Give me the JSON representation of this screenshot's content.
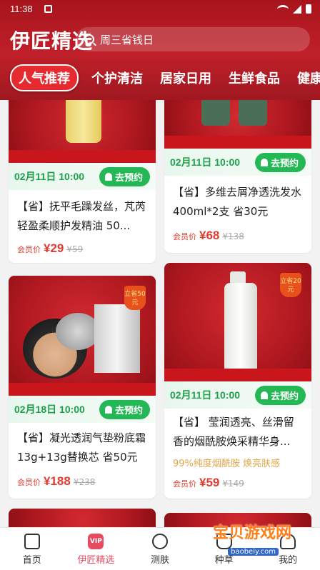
{
  "status_bar": {
    "time": "11:38"
  },
  "header": {
    "brand": "伊匠精选",
    "search_placeholder": "周三省钱日"
  },
  "tabs": [
    {
      "label": "人气推荐",
      "active": true
    },
    {
      "label": "个护清洁"
    },
    {
      "label": "居家日用"
    },
    {
      "label": "生鲜食品"
    },
    {
      "label": "健康"
    }
  ],
  "products": [
    {
      "time": "02月11日 10:00",
      "remind": "去预约",
      "title": "【省】抚平毛躁发丝，芃芮轻盈柔顺护发精油 50...",
      "member_label": "会员价",
      "price": "¥29",
      "original": "¥59"
    },
    {
      "time": "02月11日 10:00",
      "remind": "去预约",
      "title": "【省】多维去屑净透洗发水400ml*2支 省30元",
      "member_label": "会员价",
      "price": "¥68",
      "original": "¥138"
    },
    {
      "badge": "立省50元",
      "time": "02月18日 10:00",
      "remind": "去预约",
      "title": "【省】凝光透润气垫粉底霜13g+13g替换芯 省50元",
      "member_label": "会员价",
      "price": "¥188",
      "original": "¥238"
    },
    {
      "badge": "立省20元",
      "time": "02月11日 10:00",
      "remind": "去预约",
      "title": "【省】 莹润透亮、丝滑留香的烟酰胺焕采精华身...",
      "tagline": "99%纯度烟酰胺 焕亮肤感",
      "member_label": "会员价",
      "price": "¥59",
      "original": "¥149"
    }
  ],
  "bottom_nav": [
    {
      "label": "首页"
    },
    {
      "label": "伊匠精选",
      "active": true
    },
    {
      "label": "测肤"
    },
    {
      "label": "种草"
    },
    {
      "label": "我的"
    }
  ],
  "watermark": {
    "text": "宝贝游戏网",
    "url": "baobeiy.com"
  },
  "colors": {
    "accent_red": "#c0202a",
    "green": "#24b755",
    "price_red": "#e23c32"
  }
}
